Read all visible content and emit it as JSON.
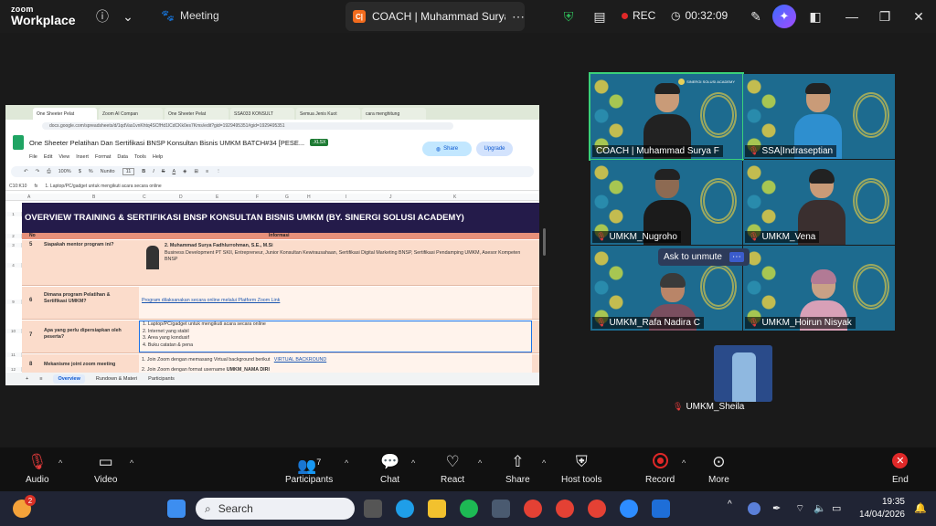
{
  "topbar": {
    "logo_top": "zoom",
    "logo_bottom": "Workplace",
    "meeting_label": "Meeting",
    "coach_badge": "C|",
    "coach_title": "COACH | Muhammad Surya F's sc",
    "rec_label": "REC",
    "timer": "00:32:09"
  },
  "sheet": {
    "browser_tabs": [
      "One Sheeter Pelat",
      "Zoom AI Compan",
      "One Sheeter Pelat",
      "SSA033 KONSULT",
      "Semua Jenis Kuot",
      "cara menghitung"
    ],
    "address": "docs.google.com/spreadsheets/d/1qdVas1vnKhtq4SCfHd1lCdCKk0es7Kms/edit?gid=1929495351#gid=1929495351",
    "title": "One Sheeter Pelatihan Dan Sertifikasi BNSP Konsultan Bisnis UMKM BATCH#34 [PESE...",
    "file_badge": ".XLSX",
    "menus": [
      "File",
      "Edit",
      "View",
      "Insert",
      "Format",
      "Data",
      "Tools",
      "Help"
    ],
    "share_label": "Share",
    "upgrade_label": "Upgrade",
    "zoom_level": "100%",
    "font_name": "Nunito",
    "font_size": "11",
    "cell_ref": "C10:K10",
    "formula_text": "1. Laptop/PC/gadget untuk mengikuti acara secara online",
    "columns": [
      "A",
      "B",
      "C",
      "D",
      "E",
      "F",
      "G",
      "H",
      "I",
      "J",
      "K"
    ],
    "row_numbers": [
      "1",
      "2",
      "3",
      "4",
      "9",
      "10",
      "11",
      "12"
    ],
    "banner": "OVERVIEW TRAINING & SERTIFIKASI BNSP KONSULTAN BISNIS UMKM (BY. SINERGI SOLUSI ACADEMY)",
    "header_no": "No",
    "header_info": "Informasi",
    "rows": [
      {
        "no": "5",
        "question": "Siapakah mentor program ini?",
        "info_line1": "2. Muhammad Surya Fadhlurrohman, S.E., M.Si",
        "info_line2": "Business Development PT SKII, Entrepreneur, Junior Konsultan Kewirausahaan, Sertifikasi Digital Marketing BNSP, Sertifikasi Pendamping UMKM, Asesor Kompeten BNSP"
      },
      {
        "no": "6",
        "question": "Dimana program Pelatihan & Sertifikasi UMKM?",
        "info_link": "Program dilaksanakan secara online melalui Platform Zoom Link"
      },
      {
        "no": "7",
        "question": "Apa yang perlu dipersiapkan oleh peserta?",
        "items": [
          "1. Laptop/PC/gadget untuk mengikuti acara secara online",
          "2. Internet yang stabil",
          "3. Area yang kondusif",
          "4. Buku catatan & pena"
        ]
      },
      {
        "no": "8",
        "question": "Mekanisme joint zoom meeting",
        "info_line1": "1. Join Zoom dengan memasang Virtual background berikut",
        "info_link": "VIRTUAL BACKROUND",
        "info_line2": "2. Join Zoom dengan format username",
        "info_bold": "UMKM_NAMA DIRI"
      }
    ],
    "sheet_tabs": [
      "Overview",
      "Rundown & Materi",
      "Participants"
    ]
  },
  "participants": [
    {
      "name": "COACH | Muhammad Surya F",
      "muted": false
    },
    {
      "name": "SSA|Indraseptian",
      "muted": true
    },
    {
      "name": "UMKM_Nugroho",
      "muted": true
    },
    {
      "name": "UMKM_Vena",
      "muted": true
    },
    {
      "name": "UMKM_Rafa Nadira C",
      "muted": true
    },
    {
      "name": "UMKM_Hoirun Nisyak",
      "muted": true
    }
  ],
  "tile_logo_text": "SINERGI SOLUSI ACADEMY",
  "unmute_prompt": "Ask to unmute",
  "self_view_name": "UMKM_Sheila",
  "controls": {
    "audio": "Audio",
    "video": "Video",
    "participants": "Participants",
    "participant_count": "7",
    "chat": "Chat",
    "react": "React",
    "share": "Share",
    "host_tools": "Host tools",
    "record": "Record",
    "more": "More",
    "end": "End"
  },
  "taskbar": {
    "search_placeholder": "Search",
    "time": "19:35",
    "date": "14/04/2026",
    "weather_badge": "2"
  },
  "colors": {
    "banner": "#241b4a",
    "header_row": "#e6907a",
    "row_fill": "#fbdccb",
    "active_speaker": "#3ad07a",
    "record_red": "#e02828"
  }
}
